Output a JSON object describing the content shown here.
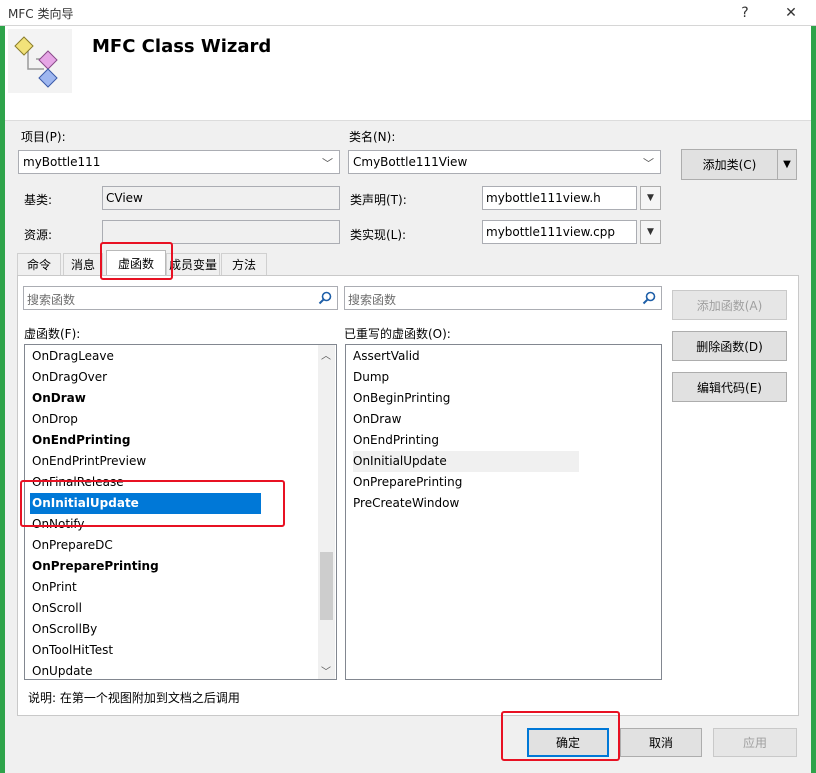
{
  "window": {
    "title": "MFC 类向导",
    "help": "?",
    "close": "✕"
  },
  "header": {
    "title": "MFC Class Wizard",
    "icon": "class-wizard-icon"
  },
  "project": {
    "label": "项目(P):",
    "value": "myBottle111"
  },
  "classname": {
    "label": "类名(N):",
    "value": "CmyBottle111View"
  },
  "add_class": {
    "label": "添加类(C)"
  },
  "base": {
    "label": "基类:",
    "value": "CView"
  },
  "resource": {
    "label": "资源:",
    "value": ""
  },
  "declaration": {
    "label": "类声明(T):",
    "value": "mybottle111view.h"
  },
  "implementation": {
    "label": "类实现(L):",
    "value": "mybottle111view.cpp"
  },
  "tabs": [
    {
      "label": "命令"
    },
    {
      "label": "消息"
    },
    {
      "label": "虚函数"
    },
    {
      "label": "成员变量"
    },
    {
      "label": "方法"
    }
  ],
  "search_left": {
    "placeholder": "搜索函数"
  },
  "search_right": {
    "placeholder": "搜索函数"
  },
  "virtual_list": {
    "label": "虚函数(F):",
    "items": [
      {
        "text": "OnDragLeave",
        "bold": false
      },
      {
        "text": "OnDragOver",
        "bold": false
      },
      {
        "text": "OnDraw",
        "bold": true
      },
      {
        "text": "OnDrop",
        "bold": false
      },
      {
        "text": "OnEndPrinting",
        "bold": true
      },
      {
        "text": "OnEndPrintPreview",
        "bold": false
      },
      {
        "text": "OnFinalRelease",
        "bold": false
      },
      {
        "text": "OnInitialUpdate",
        "bold": true,
        "selected": true
      },
      {
        "text": "OnNotify",
        "bold": false
      },
      {
        "text": "OnPrepareDC",
        "bold": false
      },
      {
        "text": "OnPreparePrinting",
        "bold": true
      },
      {
        "text": "OnPrint",
        "bold": false
      },
      {
        "text": "OnScroll",
        "bold": false
      },
      {
        "text": "OnScrollBy",
        "bold": false
      },
      {
        "text": "OnToolHitTest",
        "bold": false
      },
      {
        "text": "OnUpdate",
        "bold": false
      }
    ]
  },
  "overridden_list": {
    "label": "已重写的虚函数(O):",
    "items": [
      {
        "text": "AssertValid"
      },
      {
        "text": "Dump"
      },
      {
        "text": "OnBeginPrinting"
      },
      {
        "text": "OnDraw"
      },
      {
        "text": "OnEndPrinting"
      },
      {
        "text": "OnInitialUpdate",
        "highlight": true
      },
      {
        "text": "OnPreparePrinting"
      },
      {
        "text": "PreCreateWindow"
      }
    ]
  },
  "actions": {
    "add": "添加函数(A)",
    "delete": "删除函数(D)",
    "edit": "编辑代码(E)"
  },
  "description": {
    "text": "说明:   在第一个视图附加到文档之后调用"
  },
  "footer": {
    "ok": "确定",
    "cancel": "取消",
    "apply": "应用"
  }
}
